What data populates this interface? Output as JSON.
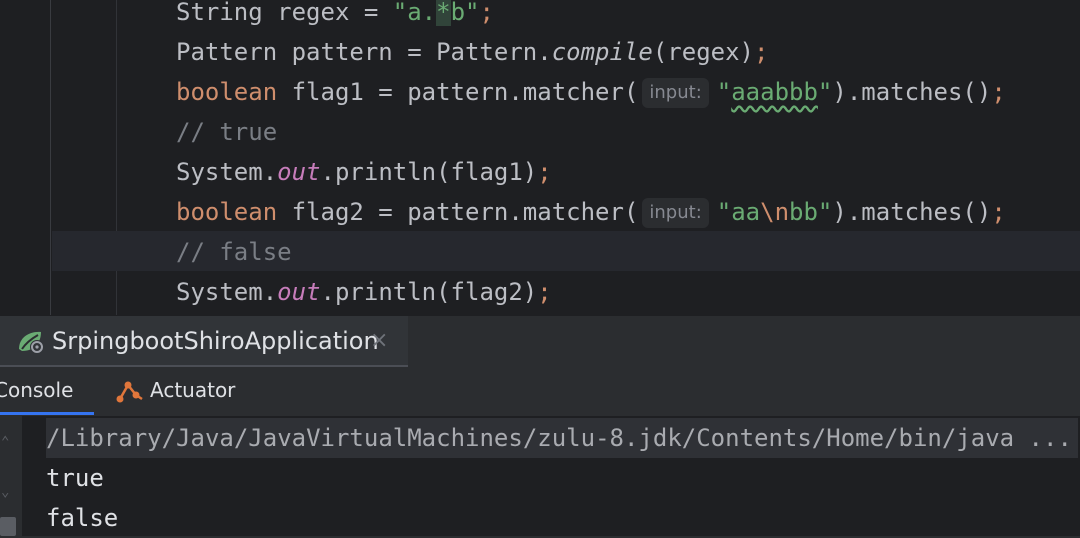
{
  "editor": {
    "lines": {
      "l1": {
        "p1": "String regex = ",
        "s1": "\"a.",
        "s2": "*",
        "s3": "b\"",
        "semi": ";"
      },
      "l2": {
        "p1": "Pattern pattern = Pattern.",
        "method": "compile",
        "p2": "(regex)",
        "semi": ";"
      },
      "l3": {
        "kw": "boolean",
        "p1": " flag1 = pattern.matcher(",
        "hint": "input:",
        "q1": "\"",
        "s1": "aaabbb",
        "q2": "\"",
        "p2": ").matches()",
        "semi": ";"
      },
      "l4": {
        "cmt": "// true"
      },
      "l5": {
        "p1": "System.",
        "field": "out",
        "p2": ".println(flag1)",
        "semi": ";"
      },
      "l6": {
        "kw": "boolean",
        "p1": " flag2 = pattern.matcher(",
        "hint": "input:",
        "s1": "\"aa",
        "esc": "\\n",
        "s2": "bb\"",
        "p2": ").matches()",
        "semi": ";"
      },
      "l7": {
        "cmt": "// false"
      },
      "l8": {
        "p1": "System.",
        "field": "out",
        "p2": ".println(flag2)",
        "semi": ";"
      }
    }
  },
  "run_window": {
    "title": "SrpingbootShiroApplication",
    "close_glyph": "×",
    "tabs": {
      "console": "Console",
      "actuator": "Actuator"
    },
    "output": [
      "/Library/Java/JavaVirtualMachines/zulu-8.jdk/Contents/Home/bin/java ...",
      "true",
      "false"
    ]
  },
  "icons": [
    "spring-icon",
    "close-icon",
    "actuator-icon",
    "up-arrow-icon",
    "down-arrow-icon",
    "scroll-end-icon"
  ],
  "colors": {
    "editor_bg": "#1e1f22",
    "panel_bg": "#2b2d30",
    "keyword": "#cf8e6d",
    "string": "#6aab73",
    "comment": "#7a7e85",
    "field": "#c77dbb",
    "text": "#bcbec4",
    "accent": "#3574f0"
  }
}
